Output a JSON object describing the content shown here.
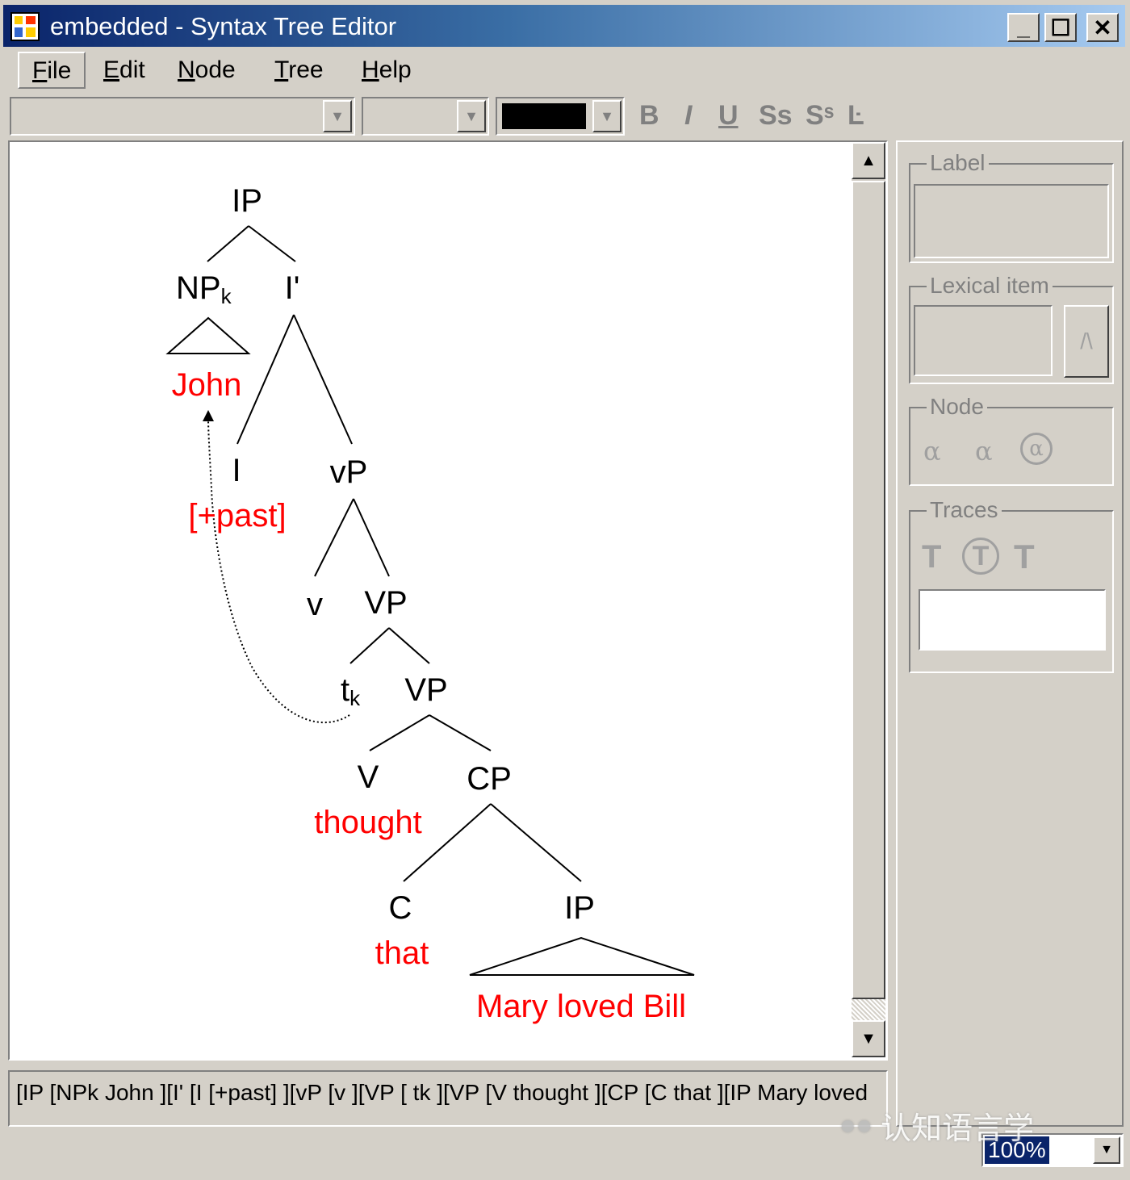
{
  "window": {
    "title": "embedded - Syntax Tree Editor",
    "controls": {
      "minimize": "_",
      "maximize": "☐",
      "close": "✕"
    }
  },
  "menu": {
    "items": [
      "File",
      "Edit",
      "Node",
      "Tree",
      "Help"
    ]
  },
  "toolbar": {
    "font_color": "#000000",
    "format_buttons": [
      "B",
      "I",
      "U",
      "Ss",
      "Sˢ",
      "Ŀ"
    ]
  },
  "tree": {
    "nodes": {
      "ip_root": "IP",
      "np": "NP",
      "np_sub": "k",
      "ibar": "I'",
      "i": "I",
      "vp_small": "vP",
      "v_small": "v",
      "vp1": "VP",
      "t": "t",
      "t_sub": "k",
      "vp2": "VP",
      "v": "V",
      "cp": "CP",
      "c": "C",
      "ip_embedded": "IP"
    },
    "words": {
      "john": "John",
      "past": "[+past]",
      "thought": "thought",
      "that": "that",
      "mary": "Mary loved Bill"
    },
    "word_color": "#ff0000"
  },
  "panel": {
    "label_group": "Label",
    "lexical_group": "Lexical item",
    "lexical_button": "/\\",
    "node_group": "Node",
    "node_icons": [
      "alpha-left-icon",
      "alpha-down-icon",
      "alpha-circle-icon"
    ],
    "traces_group": "Traces",
    "trace_icons": [
      "trace-t-icon",
      "trace-t-circle-icon",
      "trace-t-bold-icon"
    ]
  },
  "bracket_text": "[IP [NPk John ][I' [I [+past] ][vP [v ][VP [ tk ][VP [V thought ][CP [C that ][IP Mary loved",
  "status": {
    "zoom": "100%"
  },
  "watermark": "认知语言学"
}
